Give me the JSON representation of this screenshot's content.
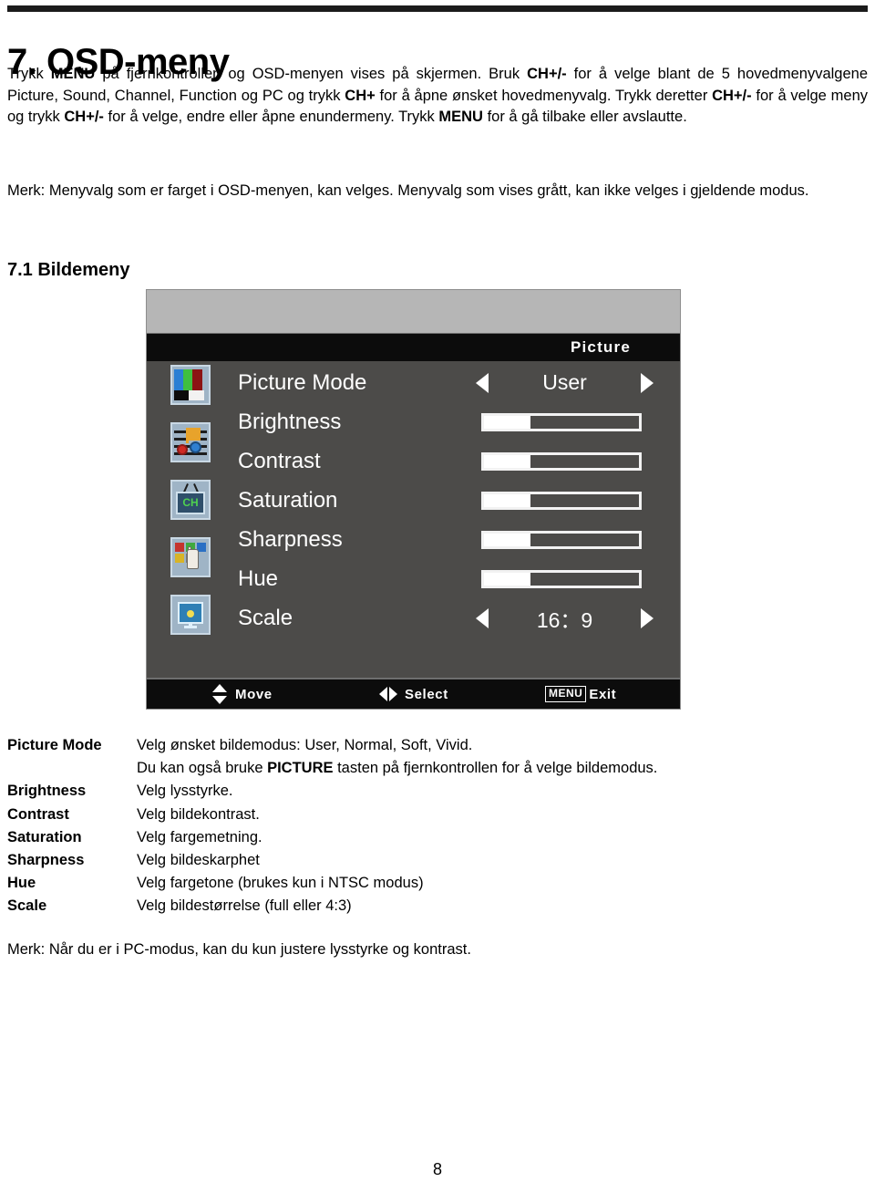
{
  "document": {
    "heading": "7. OSD-meny",
    "subheading": "7.1 Bildemeny",
    "page_number": "8",
    "intro": {
      "line_a_1": "Trykk ",
      "line_a_b1": "MENU",
      "line_a_2": " på fjernkontrollen og OSD-menyen vises på skjermen. Bruk ",
      "line_a_b2": "CH+/-",
      "line_a_3": " for å velge blant de 5 hovedmenyvalgene Picture, Sound, Channel, Function og PC og trykk ",
      "line_a_b3": "CH+",
      "line_a_4": " for å åpne ønsket hovedmenyvalg. Trykk deretter ",
      "line_a_b4": "CH+/-",
      "line_a_5": " for å velge meny og trykk ",
      "line_a_b5": "CH+/-",
      "line_a_6": " for å velge, endre eller åpne enundermeny. Trykk ",
      "line_a_b6": "MENU",
      "line_a_7": " for å gå tilbake eller avslautte."
    },
    "merk_paragraph": "Merk: Menyvalg som er farget i OSD-menyen, kan velges. Menyvalg som vises grått, kan ikke velges i gjeldende modus.",
    "footer_note": "Merk: Når du er i PC-modus, kan du kun justere lysstyrke og kontrast."
  },
  "osd": {
    "title": "Picture",
    "colors": {
      "panel_bg": "#4c4b49",
      "title_bar": "#0c0c0c",
      "top_band": "#b6b6b6",
      "text": "#ffffff"
    },
    "icons": [
      {
        "name": "color-bars-icon"
      },
      {
        "name": "music-note-gears-icon"
      },
      {
        "name": "tv-channel-icon"
      },
      {
        "name": "hand-squares-icon"
      },
      {
        "name": "monitor-icon"
      }
    ],
    "rows": [
      {
        "label": "Picture  Mode",
        "type": "option",
        "value": "User"
      },
      {
        "label": "Brightness",
        "type": "slider",
        "value": 30
      },
      {
        "label": "Contrast",
        "type": "slider",
        "value": 30
      },
      {
        "label": "Saturation",
        "type": "slider",
        "value": 30
      },
      {
        "label": "Sharpness",
        "type": "slider",
        "value": 30
      },
      {
        "label": "Hue",
        "type": "slider",
        "value": 30
      },
      {
        "label": "Scale",
        "type": "option",
        "value": "16：9"
      }
    ],
    "footer": {
      "move_label": "Move",
      "select_label": "Select",
      "menu_key_label": "MENU",
      "exit_label": "Exit"
    }
  },
  "descriptions": [
    {
      "term": "Picture Mode",
      "definition": "Velg ønsket bildemodus: User, Normal, Soft, Vivid.",
      "continuation_pre": "Du kan også bruke ",
      "continuation_bold": "PICTURE",
      "continuation_post": " tasten på fjernkontrollen for å velge bildemodus."
    },
    {
      "term": "Brightness",
      "definition": "Velg lysstyrke."
    },
    {
      "term": "Contrast",
      "definition": "Velg bildekontrast."
    },
    {
      "term": "Saturation",
      "definition": "Velg fargemetning."
    },
    {
      "term": "Sharpness",
      "definition": "Velg bildeskarphet"
    },
    {
      "term": "Hue",
      "definition": "Velg fargetone (brukes kun i NTSC modus)"
    },
    {
      "term": "Scale",
      "definition": "Velg bildestørrelse (full eller 4:3)"
    }
  ]
}
